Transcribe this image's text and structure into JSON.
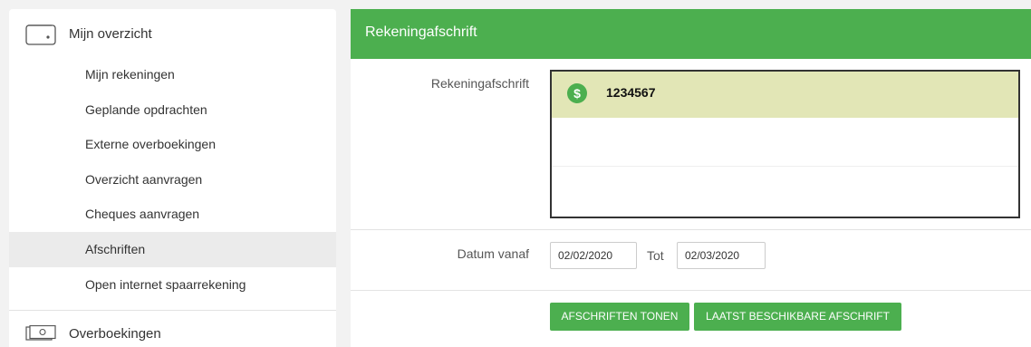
{
  "sidebar": {
    "title": "Mijn overzicht",
    "items": [
      {
        "label": "Mijn rekeningen"
      },
      {
        "label": "Geplande opdrachten"
      },
      {
        "label": "Externe overboekingen"
      },
      {
        "label": "Overzicht aanvragen"
      },
      {
        "label": "Cheques aanvragen"
      },
      {
        "label": "Afschriften",
        "active": true
      },
      {
        "label": "Open internet spaarrekening"
      }
    ],
    "footer": {
      "label": "Overboekingen"
    }
  },
  "panel": {
    "title": "Rekeningafschrift",
    "account_label": "Rekeningafschrift",
    "accounts": [
      {
        "icon": "$",
        "number": "1234567"
      }
    ],
    "date_label": "Datum vanaf",
    "date_from": "02/02/2020",
    "to_label": "Tot",
    "date_to": "02/03/2020",
    "show_button": "AFSCHRIFTEN TONEN",
    "latest_button": "LAATST BESCHIKBARE AFSCHRIFT"
  },
  "colors": {
    "accent": "#4caf4f",
    "selected_row": "#e2e6b6"
  }
}
